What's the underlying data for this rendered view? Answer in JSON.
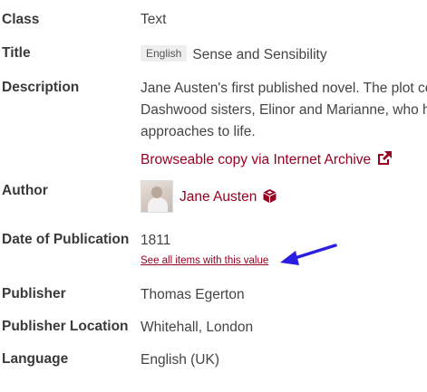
{
  "fields": {
    "class": {
      "label": "Class",
      "value": "Text"
    },
    "title": {
      "label": "Title",
      "lang_badge": "English",
      "value": "Sense and Sensibility"
    },
    "description": {
      "label": "Description",
      "lines": [
        "Jane Austen's first published novel. The plot ce",
        "Dashwood sisters, Elinor and Marianne, who h",
        "approaches to life."
      ],
      "link": "Browseable copy via Internet Archive"
    },
    "author": {
      "label": "Author",
      "value": "Jane Austen"
    },
    "date": {
      "label": "Date of Publication",
      "value": "1811",
      "see_all": "See all items with this value"
    },
    "publisher": {
      "label": "Publisher",
      "value": "Thomas Egerton"
    },
    "publisher_location": {
      "label": "Publisher Location",
      "value": "Whitehall, London"
    },
    "language": {
      "label": "Language",
      "value": "English (UK)"
    }
  },
  "colors": {
    "link": "#990022",
    "arrow": "#2a1fe0",
    "label": "#3a3a3a",
    "text": "#444444"
  },
  "icons": [
    "external-link-icon",
    "cube-icon",
    "arrow-annotation"
  ]
}
